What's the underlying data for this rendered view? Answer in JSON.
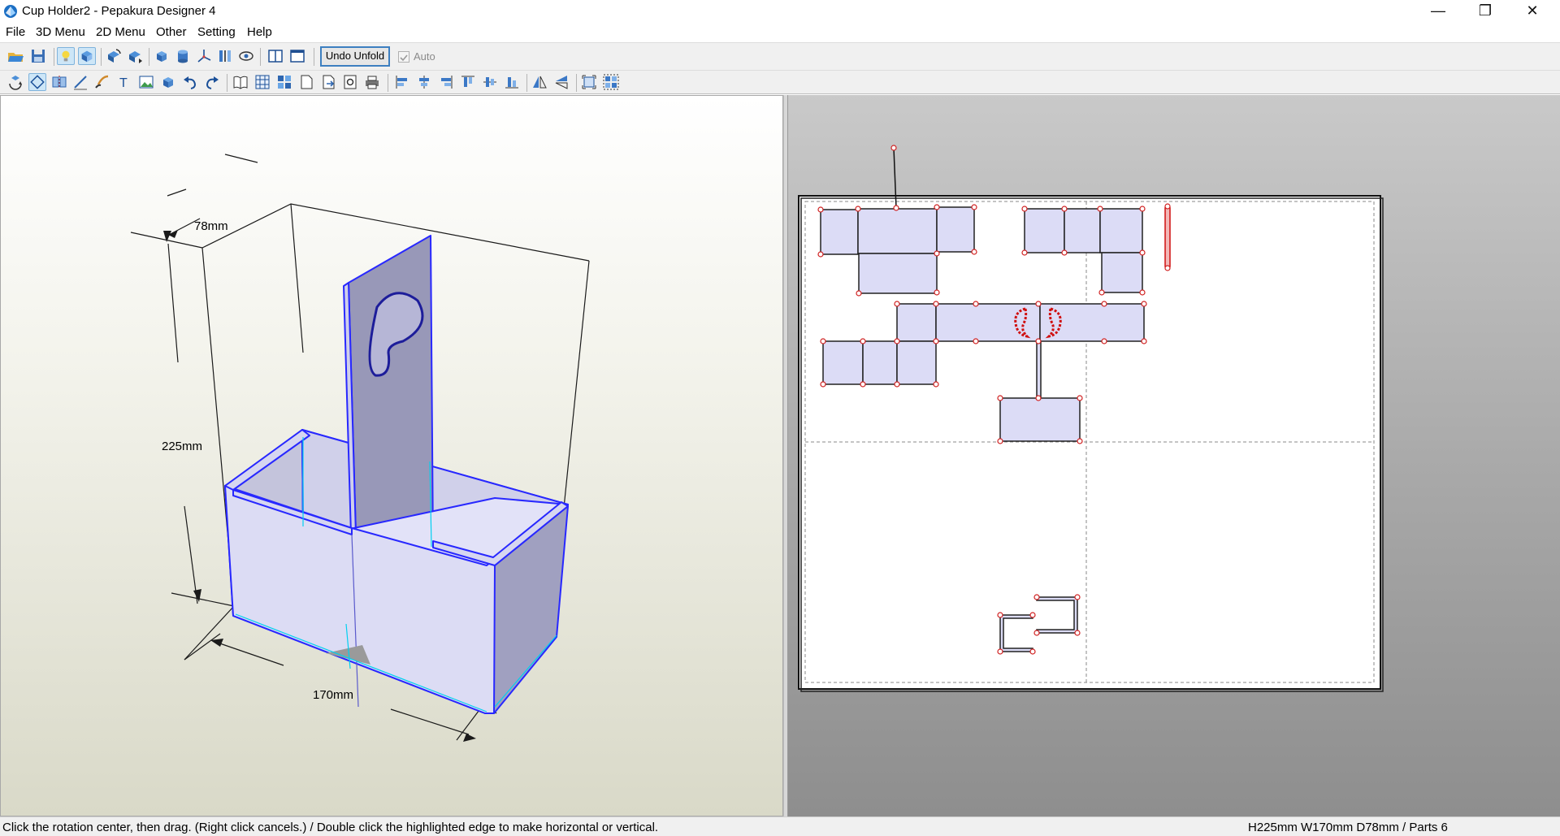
{
  "window": {
    "title": "Cup Holder2  - Pepakura Designer 4",
    "minimize": "—",
    "maximize": "❐",
    "close": "✕"
  },
  "menu": [
    "File",
    "3D Menu",
    "2D Menu",
    "Other",
    "Setting",
    "Help"
  ],
  "toolbar": {
    "undo_unfold_label": "Undo Unfold",
    "auto_label": "Auto",
    "auto_checked": true,
    "row1_icons": [
      "open-icon",
      "save-icon",
      "lightbulb-icon",
      "texture-icon",
      "rotate-icon",
      "move-icon",
      "cube-icon",
      "cylinder-icon",
      "axis-icon",
      "bars-icon",
      "eye-icon",
      "split-view-icon",
      "single-view-icon"
    ],
    "row2_icons": [
      "rotate-view-icon",
      "select-edge-icon",
      "join-icon",
      "line-icon",
      "brush-icon",
      "text-icon",
      "image-icon",
      "box-icon",
      "undo-icon",
      "redo-icon",
      "book-icon",
      "grid-icon",
      "layout-icon",
      "page-icon",
      "export-icon",
      "print-preview-icon",
      "print-icon",
      "align-left-icon",
      "align-center-icon",
      "align-right-icon",
      "align-top-icon",
      "align-middle-icon",
      "align-bottom-icon",
      "flip-h-icon",
      "flip-v-icon",
      "fit-icon",
      "arrange-icon"
    ]
  },
  "view3d": {
    "dimension_depth": "78mm",
    "dimension_height": "225mm",
    "dimension_width": "170mm",
    "model_color": "#e2e2f8",
    "edge_color": "#2828ff"
  },
  "view2d": {
    "part_fill": "#dcdcf6",
    "paper_color": "#ffffff"
  },
  "status": {
    "message": "Click the rotation center, then drag. (Right click cancels.) / Double click the highlighted edge to make horizontal or vertical.",
    "dimensions": "H225mm W170mm D78mm / Parts 6"
  }
}
